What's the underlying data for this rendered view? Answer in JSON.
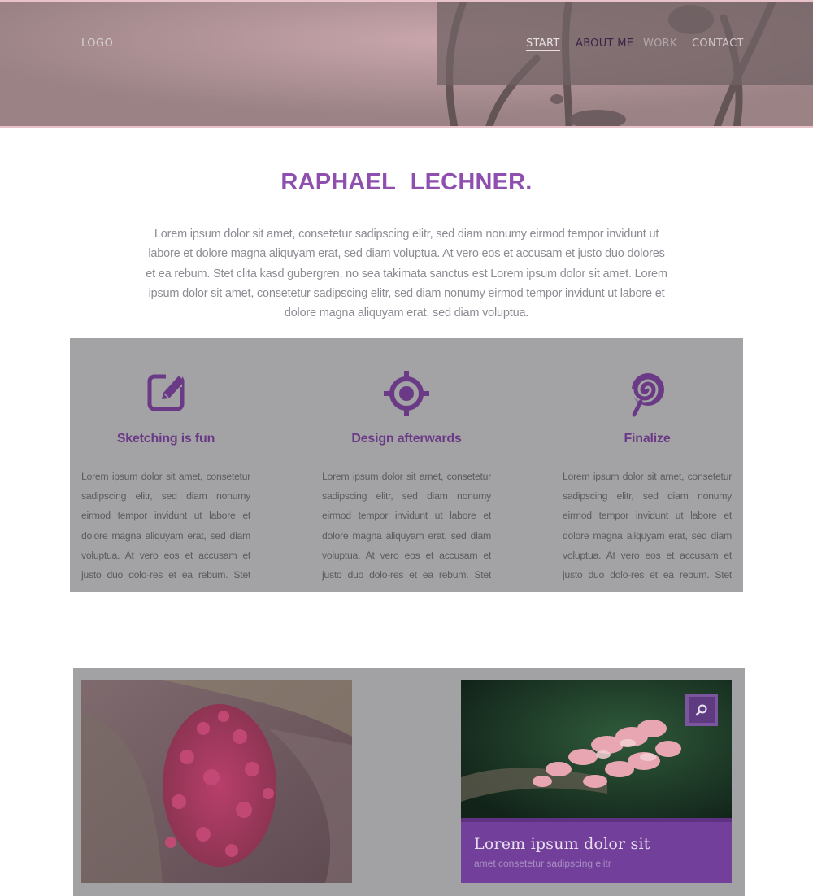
{
  "header": {
    "logo": "LOGO",
    "nav": [
      {
        "label": "START"
      },
      {
        "label": "ABOUT ME"
      },
      {
        "label": "WORK"
      },
      {
        "label": "CONTACT"
      }
    ]
  },
  "intro": {
    "title": "RAPHAEL LECHNER.",
    "text": "Lorem ipsum dolor sit amet, consetetur sadipscing elitr, sed diam nonumy eirmod tempor invidunt ut labore et dolore magna aliquyam erat, sed diam voluptua. At vero eos et accusam et justo duo dolores et ea rebum. Stet clita kasd gubergren, no sea takimata sanctus est Lorem ipsum dolor sit amet. Lorem ipsum dolor sit amet, consetetur sadipscing elitr, sed diam nonumy eirmod tempor invidunt ut labore et dolore magna aliquyam erat, sed diam voluptua."
  },
  "features": [
    {
      "icon": "edit-icon",
      "title": "Sketching is fun",
      "text": "Lorem ipsum dolor sit amet, consetetur sadipscing elitr, sed diam nonumy eirmod tempor invidunt ut labore et dolore magna aliquyam erat, sed diam voluptua. At vero eos et accusam et justo duo dolo-res et ea rebum. Stet clita kasd gubergren,"
    },
    {
      "icon": "target-icon",
      "title": "Design afterwards",
      "text": "Lorem ipsum dolor sit amet, consetetur sadipscing elitr, sed diam nonumy eirmod tempor invidunt ut labore et dolore magna aliquyam erat, sed diam voluptua. At vero eos et accusam et justo duo dolo-res et ea rebum. Stet clita kasd gubergren,"
    },
    {
      "icon": "lollipop-icon",
      "title": "Finalize",
      "text": "Lorem ipsum dolor sit amet, consetetur sadipscing elitr, sed diam nonumy eirmod tempor invidunt ut labore et dolore magna aliquyam erat, sed diam voluptua. At vero eos et accusam et justo duo dolo-res et ea rebum. Stet clita kasd gubergren,"
    }
  ],
  "gallery": {
    "card": {
      "title": "Lorem ipsum dolor sit",
      "subtitle": "amet consetetur sadipscing elitr",
      "action_icon": "search-icon"
    }
  },
  "colors": {
    "accent": "#8e4fae",
    "dark_accent": "#6b3a86",
    "feature_bg": "#a3a3a5",
    "caption_bg": "#72409a"
  }
}
